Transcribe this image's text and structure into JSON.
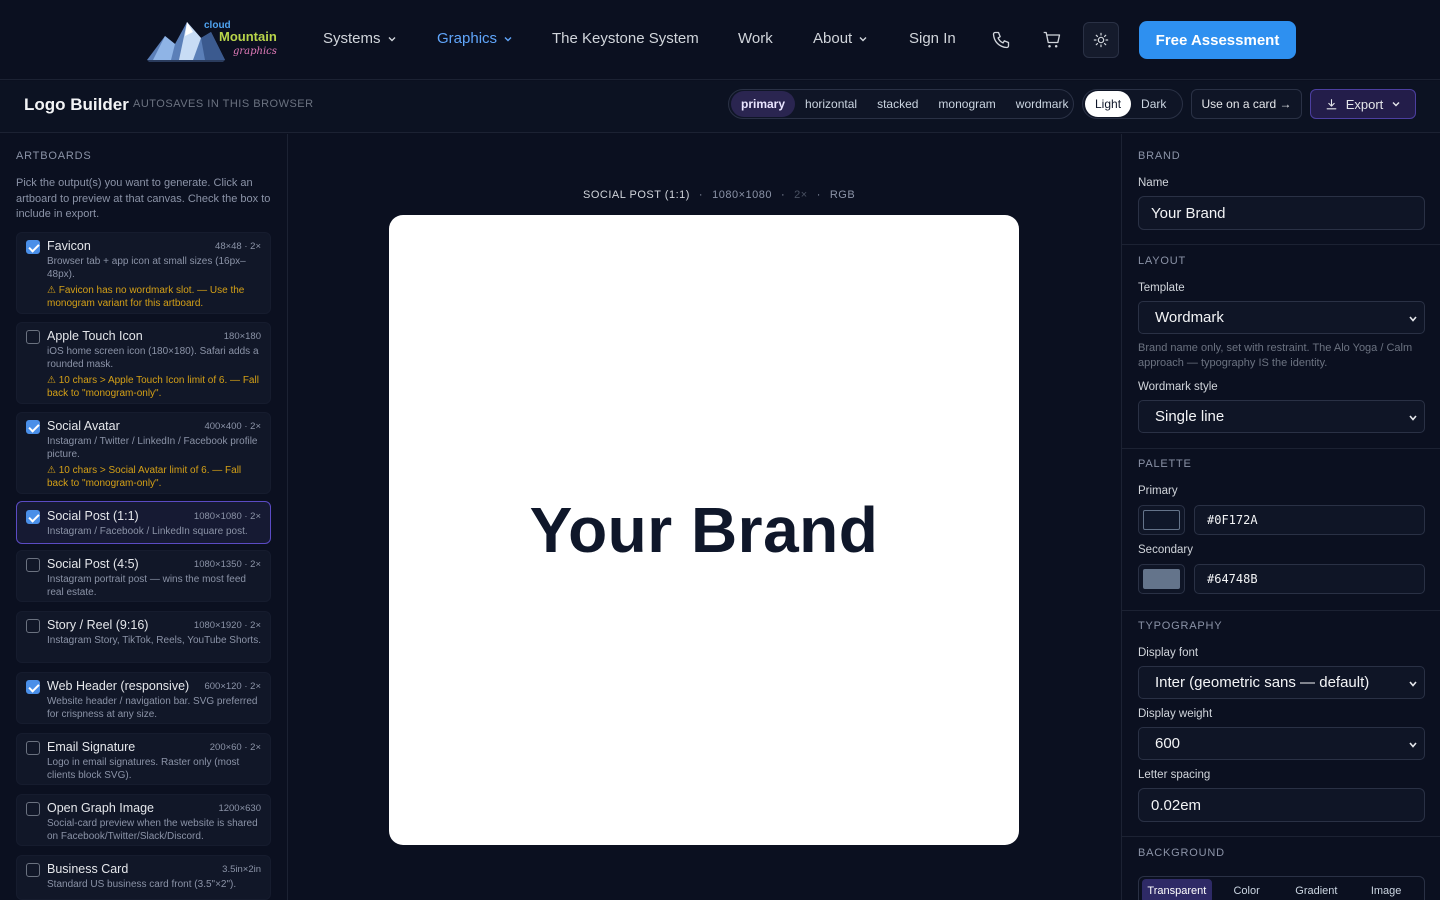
{
  "nav": {
    "logo_text": "cloud Mountain graphics",
    "items": [
      {
        "label": "Systems",
        "dropdown": true
      },
      {
        "label": "Graphics",
        "dropdown": true,
        "active": true
      },
      {
        "label": "The Keystone System",
        "dropdown": false
      },
      {
        "label": "Work",
        "dropdown": false
      },
      {
        "label": "About",
        "dropdown": true
      },
      {
        "label": "Sign In",
        "dropdown": false
      }
    ],
    "icons": [
      "phone-icon",
      "cart-icon",
      "sun-icon"
    ],
    "cta_label": "Free Assessment",
    "accent": "#2e90f0"
  },
  "toolbar": {
    "title": "Logo Builder",
    "subtitle": "AUTOSAVES IN THIS BROWSER",
    "variants": [
      "primary",
      "horizontal",
      "stacked",
      "monogram",
      "wordmark"
    ],
    "selected_variant": "primary",
    "themes": [
      "Light",
      "Dark"
    ],
    "selected_theme": "Light",
    "use_on_card_label": "Use on a card →",
    "export_label": "Export"
  },
  "artboards": {
    "heading": "ARTBOARDS",
    "description": "Pick the output(s) you want to generate. Click an artboard to preview at that canvas. Check the box to include in export.",
    "items": [
      {
        "name": "Favicon",
        "dims": "48×48 · 2×",
        "checked": true,
        "selected": false,
        "desc": "Browser tab + app icon at small sizes (16px–48px).",
        "warn": "⚠ Favicon has no wordmark slot. — Use the monogram variant for this artboard."
      },
      {
        "name": "Apple Touch Icon",
        "dims": "180×180",
        "checked": false,
        "selected": false,
        "desc": "iOS home screen icon (180×180). Safari adds a rounded mask.",
        "warn": "⚠ 10 chars > Apple Touch Icon limit of 6. — Fall back to \"monogram-only\"."
      },
      {
        "name": "Social Avatar",
        "dims": "400×400 · 2×",
        "checked": true,
        "selected": false,
        "desc": "Instagram / Twitter / LinkedIn / Facebook profile picture.",
        "warn": "⚠ 10 chars > Social Avatar limit of 6. — Fall back to \"monogram-only\"."
      },
      {
        "name": "Social Post (1:1)",
        "dims": "1080×1080 · 2×",
        "checked": true,
        "selected": true,
        "desc": "Instagram / Facebook / LinkedIn square post.",
        "warn": ""
      },
      {
        "name": "Social Post (4:5)",
        "dims": "1080×1350 · 2×",
        "checked": false,
        "selected": false,
        "desc": "Instagram portrait post — wins the most feed real estate.",
        "warn": ""
      },
      {
        "name": "Story / Reel (9:16)",
        "dims": "1080×1920 · 2×",
        "checked": false,
        "selected": false,
        "desc": "Instagram Story, TikTok, Reels, YouTube Shorts.",
        "warn": ""
      },
      {
        "name": "Web Header (responsive)",
        "dims": "600×120 · 2×",
        "checked": true,
        "selected": false,
        "desc": "Website header / navigation bar. SVG preferred for crispness at any size.",
        "warn": ""
      },
      {
        "name": "Email Signature",
        "dims": "200×60 · 2×",
        "checked": false,
        "selected": false,
        "desc": "Logo in email signatures. Raster only (most clients block SVG).",
        "warn": ""
      },
      {
        "name": "Open Graph Image",
        "dims": "1200×630",
        "checked": false,
        "selected": false,
        "desc": "Social-card preview when the website is shared on Facebook/Twitter/Slack/Discord.",
        "warn": ""
      },
      {
        "name": "Business Card",
        "dims": "3.5in×2in",
        "checked": false,
        "selected": false,
        "desc": "Standard US business card front (3.5\"×2\").",
        "warn": ""
      }
    ]
  },
  "canvas": {
    "label": "SOCIAL POST (1:1)",
    "dims": "1080×1080",
    "scale": "2×",
    "color_mode": "RGB",
    "brand_text": "Your Brand"
  },
  "panel": {
    "brand": {
      "heading": "BRAND",
      "name_label": "Name",
      "name_value": "Your Brand"
    },
    "layout": {
      "heading": "LAYOUT",
      "template_label": "Template",
      "template_value": "Wordmark",
      "template_help": "Brand name only, set with restraint. The Alo Yoga / Calm approach — typography IS the identity.",
      "wordmark_style_label": "Wordmark style",
      "wordmark_style_value": "Single line"
    },
    "palette": {
      "heading": "PALETTE",
      "primary_label": "Primary",
      "primary_value": "#0F172A",
      "secondary_label": "Secondary",
      "secondary_value": "#64748B"
    },
    "typography": {
      "heading": "TYPOGRAPHY",
      "font_label": "Display font",
      "font_value": "Inter (geometric sans — default)",
      "weight_label": "Display weight",
      "weight_value": "600",
      "spacing_label": "Letter spacing",
      "spacing_value": "0.02em"
    },
    "background": {
      "heading": "BACKGROUND",
      "options": [
        "Transparent",
        "Color",
        "Gradient",
        "Image"
      ],
      "selected": "Transparent"
    }
  }
}
